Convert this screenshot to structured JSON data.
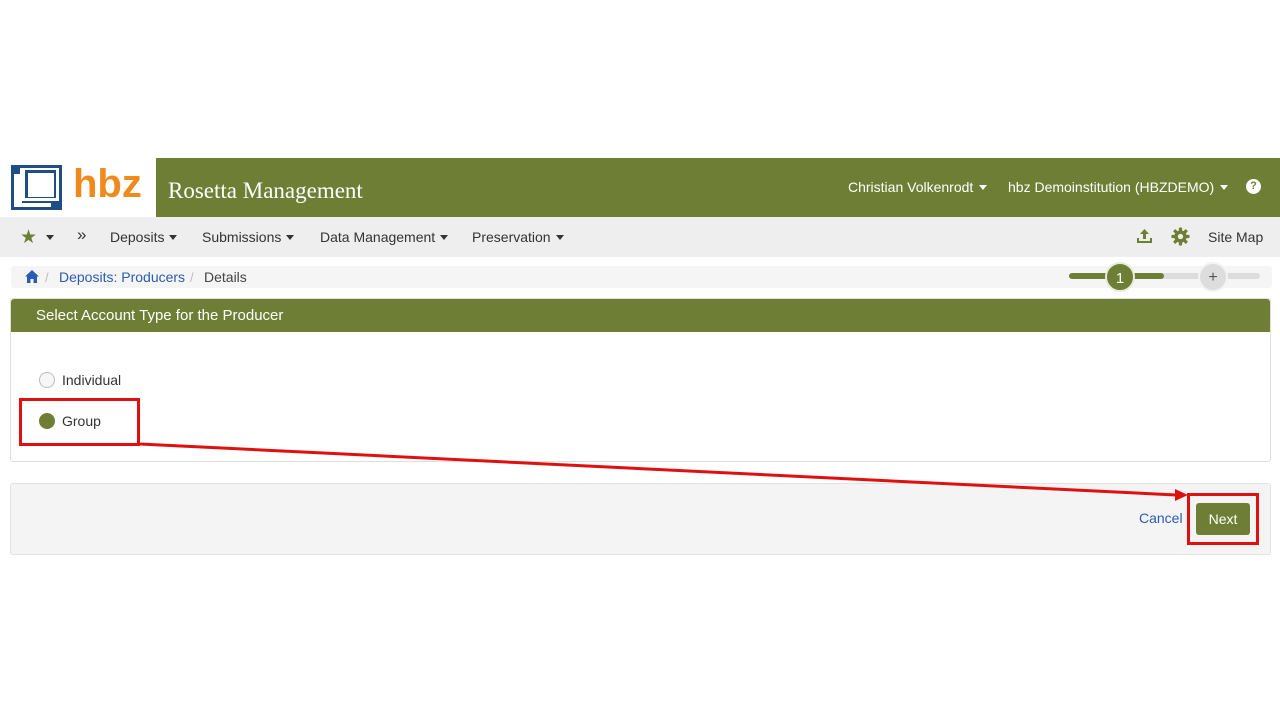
{
  "header": {
    "logo_text": "hbz",
    "app_title": "Rosetta Management",
    "user_name": "Christian Volkenrodt",
    "institution": "hbz Demoinstitution (HBZDEMO)",
    "help_symbol": "?",
    "brand_color": "#6e7f35",
    "logo_color": "#f08a1c",
    "logo_mark_color": "#1d4f86"
  },
  "nav": {
    "items": [
      {
        "label": "Deposits"
      },
      {
        "label": "Submissions"
      },
      {
        "label": "Data Management"
      },
      {
        "label": "Preservation"
      }
    ],
    "sitemap_label": "Site Map",
    "star_icon": "star-icon",
    "expand_icon": "double-chevron-icon"
  },
  "breadcrumb": {
    "link": "Deposits: Producers",
    "current": "Details"
  },
  "stepper": {
    "current_step": "1",
    "next_step": "+"
  },
  "panel": {
    "title": "Select Account Type for the Producer",
    "options": [
      {
        "label": "Individual",
        "selected": false
      },
      {
        "label": "Group",
        "selected": true
      }
    ]
  },
  "footer": {
    "cancel_label": "Cancel",
    "next_label": "Next"
  },
  "annotation": {
    "color": "#e01010"
  }
}
